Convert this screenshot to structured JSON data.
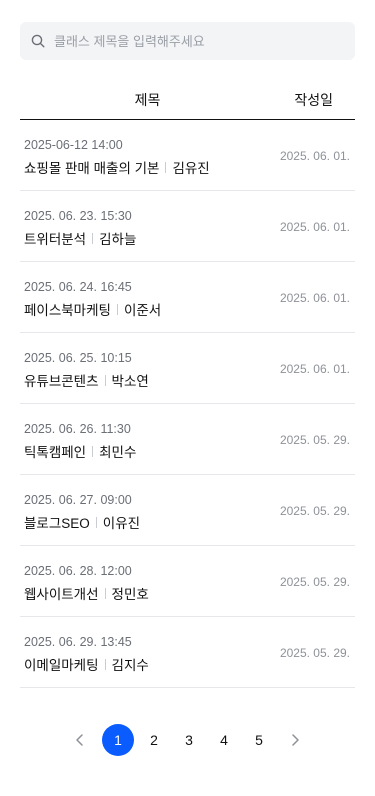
{
  "search": {
    "placeholder": "클래스 제목을 입력해주세요",
    "value": ""
  },
  "table": {
    "col_title": "제목",
    "col_date": "작성일",
    "rows": [
      {
        "datetime": "2025-06-12 14:00",
        "title": "쇼핑몰 판매 매출의 기본",
        "author": "김유진",
        "created": "2025. 06. 01."
      },
      {
        "datetime": "2025. 06. 23. 15:30",
        "title": "트위터분석",
        "author": "김하늘",
        "created": "2025. 06. 01."
      },
      {
        "datetime": "2025. 06. 24. 16:45",
        "title": "페이스북마케팅",
        "author": "이준서",
        "created": "2025. 06. 01."
      },
      {
        "datetime": "2025. 06. 25. 10:15",
        "title": "유튜브콘텐츠",
        "author": "박소연",
        "created": "2025. 06. 01."
      },
      {
        "datetime": "2025. 06. 26. 11:30",
        "title": "틱톡캠페인",
        "author": "최민수",
        "created": "2025. 05. 29."
      },
      {
        "datetime": "2025. 06. 27. 09:00",
        "title": "블로그SEO",
        "author": "이유진",
        "created": "2025. 05. 29."
      },
      {
        "datetime": "2025. 06. 28. 12:00",
        "title": "웹사이트개선",
        "author": "정민호",
        "created": "2025. 05. 29."
      },
      {
        "datetime": "2025. 06. 29. 13:45",
        "title": "이메일마케팅",
        "author": "김지수",
        "created": "2025. 05. 29."
      }
    ]
  },
  "pagination": {
    "pages": [
      "1",
      "2",
      "3",
      "4",
      "5"
    ],
    "current": "1",
    "prev_icon": "chevron-left-icon",
    "next_icon": "chevron-right-icon"
  },
  "colors": {
    "accent": "#0a5cff",
    "muted_text": "#8e9298",
    "search_bg": "#f3f4f6"
  }
}
